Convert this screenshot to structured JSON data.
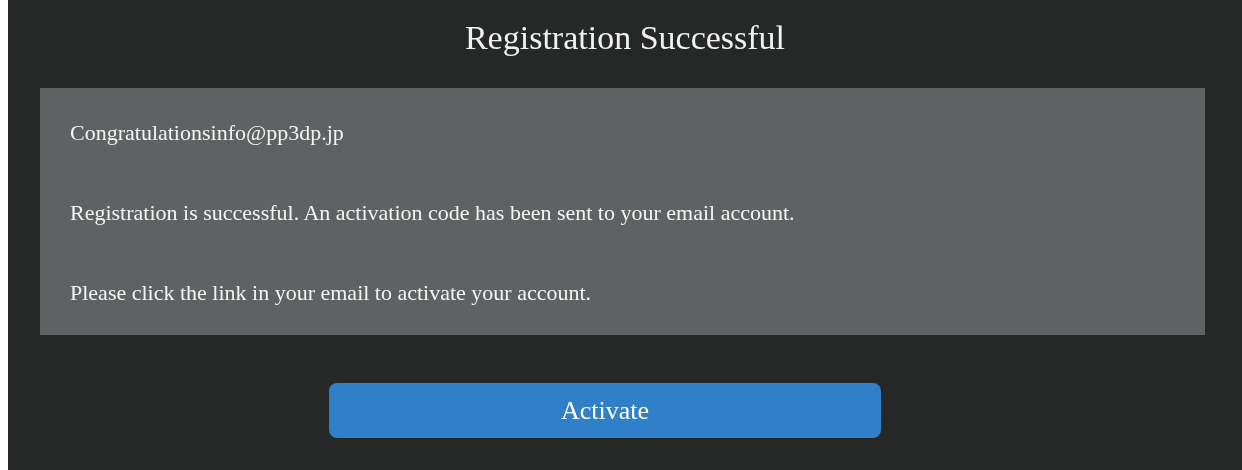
{
  "dialog": {
    "title": "Registration Successful",
    "messages": [
      "Congratulationsinfo@pp3dp.jp",
      "Registration is successful. An activation code has been sent to your email account.",
      "Please click the link in your email to activate your account."
    ],
    "button": "Activate"
  }
}
